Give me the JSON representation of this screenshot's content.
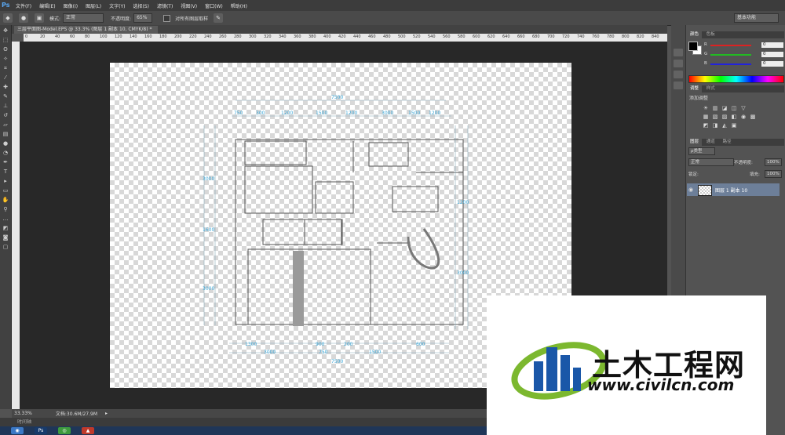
{
  "app": {
    "logo": "Ps"
  },
  "menu": [
    "文件(F)",
    "编辑(E)",
    "图像(I)",
    "图层(L)",
    "文字(Y)",
    "选择(S)",
    "滤镜(T)",
    "视图(V)",
    "窗口(W)",
    "帮助(H)"
  ],
  "options": {
    "mode_label": "模式:",
    "mode_value": "正常",
    "opacity_label": "不透明度:",
    "opacity_value": "65%",
    "align_label": "对所有图层取样",
    "workspace": "基本功能"
  },
  "document": {
    "tab_title": "三层平面图-Model.EPS @ 33.3% (图层 1 副本 10, CMYK/8) *"
  },
  "ruler_h": [
    "0",
    "20",
    "40",
    "60",
    "80",
    "100",
    "120",
    "140",
    "160",
    "180",
    "200",
    "220",
    "240",
    "260",
    "280",
    "300",
    "320",
    "340",
    "360",
    "380",
    "400",
    "420",
    "440",
    "460",
    "480",
    "500",
    "520",
    "540",
    "560",
    "580",
    "600",
    "620",
    "640",
    "660",
    "680",
    "700",
    "720",
    "740",
    "760",
    "780",
    "800",
    "820",
    "840"
  ],
  "status": {
    "zoom": "33.33%",
    "doc_size": "文档:30.6M/27.9M",
    "timeline": "时间轴"
  },
  "panels": {
    "color_tabs": [
      "颜色",
      "色板"
    ],
    "rgb": [
      {
        "label": "R",
        "value": "0",
        "color": "#d22"
      },
      {
        "label": "G",
        "value": "0",
        "color": "#2b2"
      },
      {
        "label": "B",
        "value": "0",
        "color": "#22d"
      }
    ],
    "adjust_tabs": [
      "调整",
      "样式"
    ],
    "adjust_title": "添加调整",
    "layers_tabs": [
      "图层",
      "通道",
      "路径"
    ],
    "kind_label": "ρ类型",
    "blend_mode": "正常",
    "opacity_label": "不透明度:",
    "opacity_value": "100%",
    "lock_label": "锁定:",
    "fill_label": "填充:",
    "fill_value": "100%",
    "layer_name": "图层 1 副本 10"
  },
  "plan": {
    "dims_top": [
      "750",
      "300",
      "1200",
      "1500",
      "1200",
      "3000",
      "1500",
      "1200",
      "7500"
    ],
    "dims_bottom": [
      "1300",
      "3000",
      "900",
      "200",
      "750",
      "1500",
      "600",
      "7500"
    ],
    "dims_left": [
      "3000",
      "1600",
      "3000"
    ],
    "dims_right": [
      "1200",
      "3000"
    ]
  },
  "watermark": {
    "title": "土木工程网",
    "url": "www.civilcn.com",
    "blue": "#1a57a8",
    "green": "#7cb82f"
  }
}
